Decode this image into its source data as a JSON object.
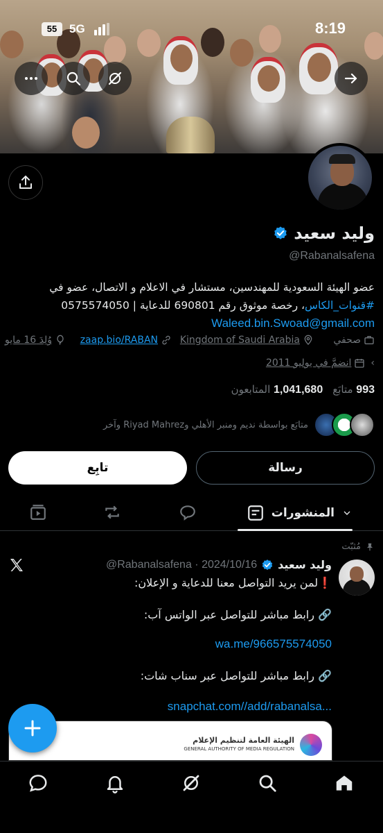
{
  "status_bar": {
    "sim_badge": "55",
    "network": "5G",
    "time": "8:19"
  },
  "profile": {
    "name": "وليد سعيد",
    "handle": "@Rabanalsafena",
    "bio_line1": "عضو الهيئة السعودية للمهندسين، مستشار في الاعلام و الاتصال، عضو في",
    "bio_hashtag": "#قنوات_الكاس",
    "bio_line2_rest": "، رخصة موثوق رقم 690801 للدعاية | 0575574050",
    "bio_email": "Waleed.bin.Swoad@gmail.com",
    "category": "صحفي",
    "location": "Kingdom of Saudi Arabia",
    "website": "zaap.bio/RABAN",
    "birthday": "وُلِدَ 16 مايو",
    "joined": "انضمَّ في يوليو 2011",
    "following_count": "993",
    "following_label": "متابَع",
    "followers_count": "1,041,680",
    "followers_label": "المتابعون",
    "known_followers": "متابَع بواسطة نديم ومنبر الأهلي وRiyad Mahrez وآخر"
  },
  "actions": {
    "message": "رسالة",
    "follow": "تابِع"
  },
  "tabs": {
    "active": "المنشورات"
  },
  "post": {
    "pinned_label": "مُثبّت",
    "author": "وليد سعيد",
    "handle_date": "@Rabanalsafena · 2024/10/16",
    "line1": "لمن يريد التواصل معنا للدعاية و الإعلان:",
    "line2": "رابط مباشر للتواصل عبر الواتس آب:",
    "link1": "wa.me/966575574050",
    "line3": "رابط مباشر للتواصل عبر سناب شات:",
    "link2": "snapchat.com//add/rabanalsa...",
    "card_org_ar": "الهيئة العامة لتنظيم الإعلام",
    "card_org_en": "GENERAL AUTHORITY OF MEDIA REGULATION"
  },
  "colors": {
    "accent": "#1d9bf0",
    "muted": "#71767b",
    "background": "#000000"
  }
}
